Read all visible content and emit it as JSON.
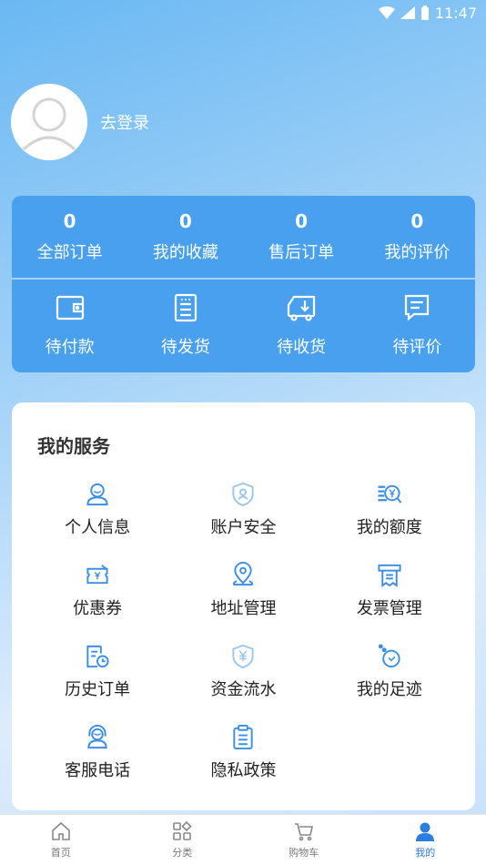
{
  "status_bar": {
    "time": "11:47"
  },
  "profile": {
    "login_text": "去登录"
  },
  "orders": {
    "counts": [
      {
        "value": "0",
        "label": "全部订单"
      },
      {
        "value": "0",
        "label": "我的收藏"
      },
      {
        "value": "0",
        "label": "售后订单"
      },
      {
        "value": "0",
        "label": "我的评价"
      }
    ],
    "statuses": [
      {
        "label": "待付款",
        "icon": "wallet-icon"
      },
      {
        "label": "待发货",
        "icon": "package-icon"
      },
      {
        "label": "待收货",
        "icon": "truck-icon"
      },
      {
        "label": "待评价",
        "icon": "comment-icon"
      }
    ]
  },
  "services": {
    "title": "我的服务",
    "items": [
      {
        "label": "个人信息",
        "icon": "user-icon"
      },
      {
        "label": "账户安全",
        "icon": "shield-user-icon"
      },
      {
        "label": "我的额度",
        "icon": "credit-search-icon"
      },
      {
        "label": "优惠券",
        "icon": "coupon-icon"
      },
      {
        "label": "地址管理",
        "icon": "location-icon"
      },
      {
        "label": "发票管理",
        "icon": "invoice-icon"
      },
      {
        "label": "历史订单",
        "icon": "history-order-icon"
      },
      {
        "label": "资金流水",
        "icon": "shield-yuan-icon"
      },
      {
        "label": "我的足迹",
        "icon": "footprint-icon"
      },
      {
        "label": "客服电话",
        "icon": "headset-icon"
      },
      {
        "label": "隐私政策",
        "icon": "clipboard-icon"
      }
    ]
  },
  "tabbar": {
    "items": [
      {
        "label": "首页",
        "icon": "home-icon"
      },
      {
        "label": "分类",
        "icon": "category-icon"
      },
      {
        "label": "购物车",
        "icon": "cart-icon"
      },
      {
        "label": "我的",
        "icon": "person-icon",
        "active": true
      }
    ]
  },
  "colors": {
    "accent": "#48a0ee",
    "icon_blue": "#3b8fe6",
    "active_tab": "#2b7de0"
  }
}
